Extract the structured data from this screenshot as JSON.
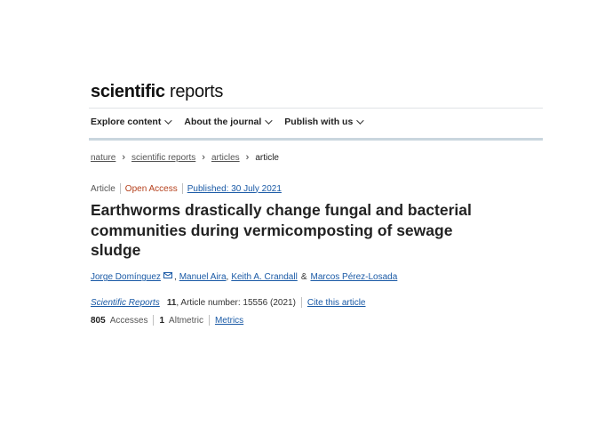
{
  "logo": {
    "bold": "scientific",
    "light": " reports"
  },
  "nav": [
    {
      "label": "Explore content"
    },
    {
      "label": "About the journal"
    },
    {
      "label": "Publish with us"
    }
  ],
  "breadcrumb": [
    "nature",
    "scientific reports",
    "articles",
    "article"
  ],
  "meta": {
    "type": "Article",
    "access": "Open Access",
    "published": "Published: 30 July 2021"
  },
  "title": "Earthworms drastically change fungal and bacterial communities during vermicomposting of sewage sludge",
  "authors": {
    "a1": "Jorge Domínguez",
    "a2": "Manuel Aira",
    "a3": "Keith A. Crandall",
    "amp": "&",
    "a4": "Marcos Pérez-Losada"
  },
  "journal": {
    "name": "Scientific Reports",
    "volume": "11",
    "rest": ", Article number: 15556 (2021)",
    "cite": "Cite this article"
  },
  "metrics": {
    "accesses_num": "805",
    "accesses_label": "Accesses",
    "altmetric_num": "1",
    "altmetric_label": "Altmetric",
    "metrics_link": "Metrics"
  },
  "colors": {
    "link": "#1a5aa6",
    "open_access": "#b5401c"
  }
}
